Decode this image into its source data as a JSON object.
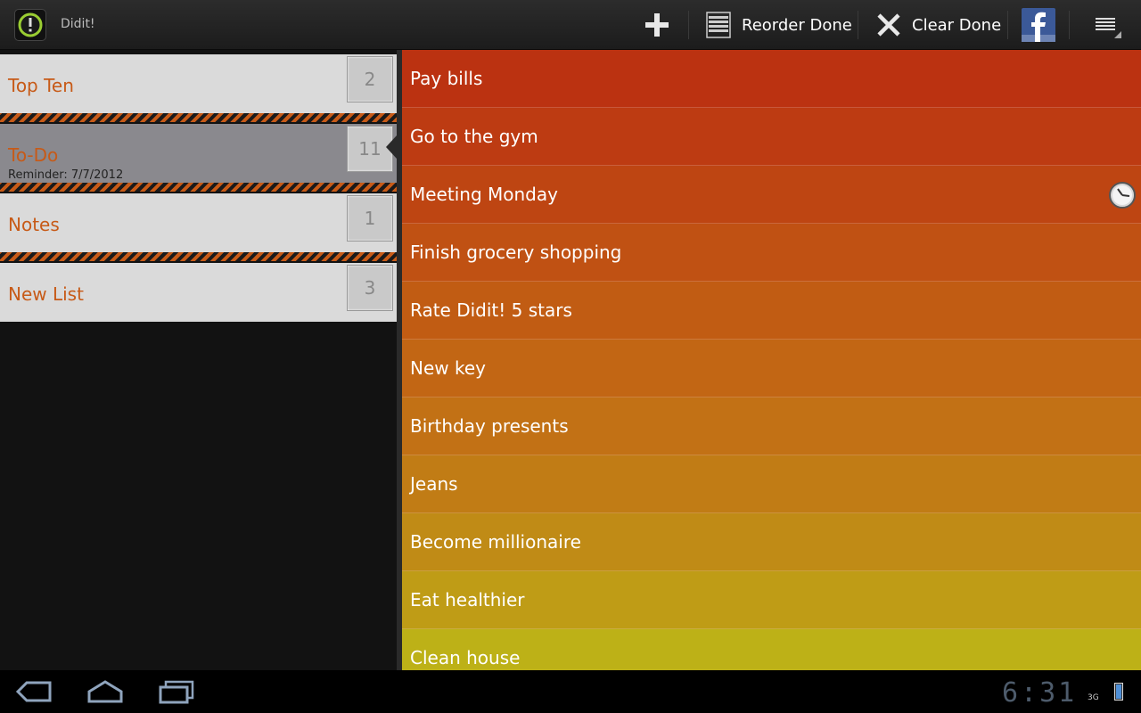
{
  "app": {
    "title": "Didit!"
  },
  "actionbar": {
    "reorder_label": "Reorder Done",
    "clear_label": "Clear Done"
  },
  "lists": [
    {
      "name": "Top Ten",
      "count": "2",
      "reminder": ""
    },
    {
      "name": "To-Do",
      "count": "11",
      "reminder": "Reminder: 7/7/2012"
    },
    {
      "name": "Notes",
      "count": "1",
      "reminder": ""
    },
    {
      "name": "New List",
      "count": "3",
      "reminder": ""
    }
  ],
  "tasks": [
    {
      "text": "Pay bills",
      "color": "#bb3211"
    },
    {
      "text": "Go to the gym",
      "color": "#bd3b12"
    },
    {
      "text": "Meeting Monday",
      "color": "#be4512",
      "has_reminder": true
    },
    {
      "text": "Finish grocery shopping",
      "color": "#c05113"
    },
    {
      "text": "Rate Didit! 5 stars",
      "color": "#c15c13"
    },
    {
      "text": "New key",
      "color": "#c26614"
    },
    {
      "text": "Birthday presents",
      "color": "#c27115"
    },
    {
      "text": "Jeans",
      "color": "#c17c15"
    },
    {
      "text": "Become millionaire",
      "color": "#c08b16"
    },
    {
      "text": "Eat healthier",
      "color": "#bf9c16"
    },
    {
      "text": "Clean house",
      "color": "#bdb117"
    }
  ],
  "statusbar": {
    "time": "6:31",
    "network": "3G"
  },
  "colors": {
    "accent": "#c75a17",
    "actionbar": "#1c1c1c",
    "selected": "#8a898e"
  }
}
